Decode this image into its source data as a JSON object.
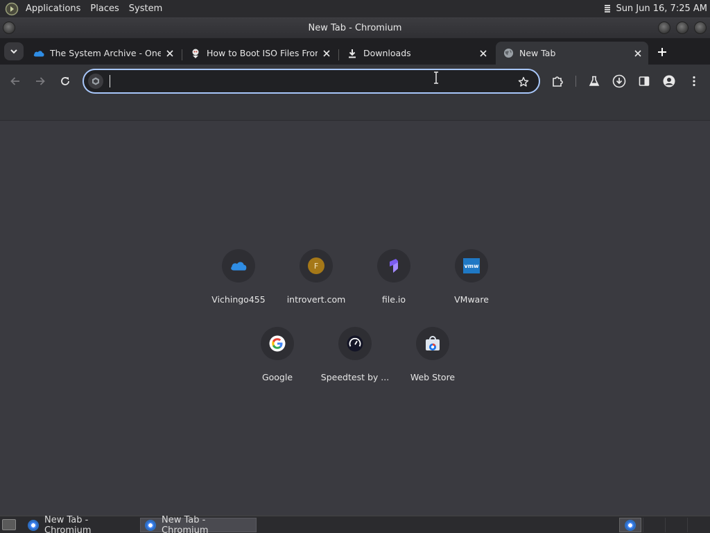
{
  "top_panel": {
    "menus": [
      "Applications",
      "Places",
      "System"
    ],
    "clock": "Sun Jun 16,  7:25 AM"
  },
  "window": {
    "title": "New Tab - Chromium"
  },
  "tabs": [
    {
      "title": "The System Archive - OneDrive",
      "favicon": "onedrive-icon"
    },
    {
      "title": "How to Boot ISO Files From",
      "favicon": "article-icon"
    },
    {
      "title": "Downloads",
      "favicon": "download-icon"
    },
    {
      "title": "New Tab",
      "favicon": "globe-icon",
      "active": true
    }
  ],
  "omnibox": {
    "value": "",
    "placeholder": ""
  },
  "shortcuts": [
    {
      "label": "Vichingo455",
      "icon": "onedrive-icon"
    },
    {
      "label": "introvert.com",
      "icon": "letter-f-icon",
      "letter": "F"
    },
    {
      "label": "file.io",
      "icon": "fileio-icon"
    },
    {
      "label": "VMware",
      "icon": "vmware-icon",
      "letter": "vmw"
    },
    {
      "label": "Google",
      "icon": "google-icon"
    },
    {
      "label": "Speedtest by ...",
      "icon": "speedtest-icon"
    },
    {
      "label": "Web Store",
      "icon": "webstore-icon"
    }
  ],
  "taskbar": {
    "items": [
      "New Tab - Chromium",
      "New Tab - Chromium"
    ]
  },
  "colors": {
    "accent": "#a8c7fa",
    "background": "#3a3a40",
    "tab_strip": "#1f1f22",
    "toolbar": "#35363a"
  }
}
